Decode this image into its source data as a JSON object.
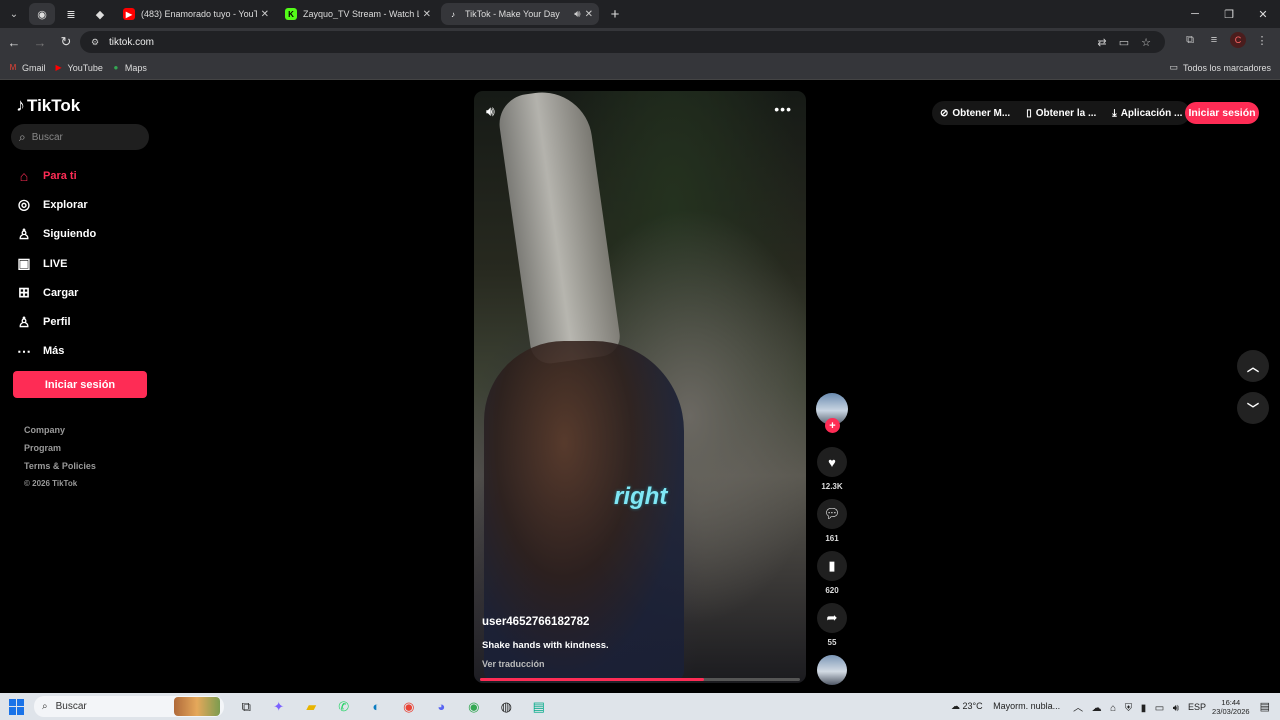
{
  "browser": {
    "tabs": [
      {
        "title": "(483) Enamorado tuyo - YouTube",
        "favicon": "youtube-icon",
        "active": false
      },
      {
        "title": "Zayquo_TV Stream - Watch Live",
        "favicon": "kick-icon",
        "active": false
      },
      {
        "title": "TikTok - Make Your Day",
        "favicon": "tiktok-icon",
        "active": true
      }
    ],
    "url": "tiktok.com",
    "bookmarks": [
      {
        "label": "Gmail",
        "icon": "gmail-icon"
      },
      {
        "label": "YouTube",
        "icon": "youtube-icon"
      },
      {
        "label": "Maps",
        "icon": "maps-icon"
      }
    ],
    "all_bookmarks": "Todos los marcadores",
    "profile_initial": "C"
  },
  "tiktok": {
    "logo": "TikTok",
    "search_placeholder": "Buscar",
    "nav": [
      {
        "label": "Para ti",
        "icon": "home-icon",
        "active": true
      },
      {
        "label": "Explorar",
        "icon": "compass-icon",
        "active": false
      },
      {
        "label": "Siguiendo",
        "icon": "following-icon",
        "active": false
      },
      {
        "label": "LIVE",
        "icon": "live-icon",
        "active": false
      },
      {
        "label": "Cargar",
        "icon": "upload-icon",
        "active": false
      },
      {
        "label": "Perfil",
        "icon": "profile-icon",
        "active": false
      },
      {
        "label": "Más",
        "icon": "more-icon",
        "active": false
      }
    ],
    "login_button": "Iniciar sesión",
    "footer_links": [
      "Company",
      "Program",
      "Terms & Policies"
    ],
    "copyright": "© 2026 TikTok",
    "top_actions": [
      {
        "label": "Obtener M...",
        "icon": "coin-icon"
      },
      {
        "label": "Obtener la ...",
        "icon": "phone-icon"
      },
      {
        "label": "Aplicación ...",
        "icon": "download-icon"
      }
    ],
    "top_login": "Iniciar sesión",
    "video": {
      "username": "user4652766182782",
      "caption": "Shake hands with kindness.",
      "translate": "Ver traducción",
      "overlay_text": "right",
      "progress": 0.7
    },
    "actions": {
      "likes": "12.3K",
      "comments": "161",
      "saves": "620",
      "shares": "55"
    }
  },
  "taskbar": {
    "search_placeholder": "Buscar",
    "weather_temp": "23°C",
    "weather_text": "Mayorm. nubla...",
    "language": "ESP",
    "time": "16:44",
    "date": "23/03/2026"
  }
}
